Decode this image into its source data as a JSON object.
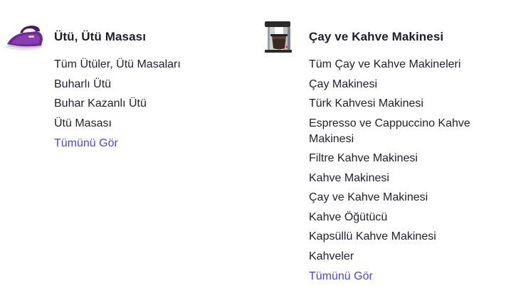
{
  "categories": [
    {
      "title": "Ütü, Ütü Masası",
      "thumbnail_icon": "steam-iron-icon",
      "links": [
        "Tüm Ütüler, Ütü Masaları",
        "Buharlı Ütü",
        "Buhar Kazanlı Ütü",
        "Ütü Masası"
      ],
      "see_all": "Tümünü Gör"
    },
    {
      "title": "Çay ve Kahve Makinesi",
      "thumbnail_icon": "coffee-machine-icon",
      "links": [
        "Tüm Çay ve Kahve Makineleri",
        "Çay Makinesi",
        "Türk Kahvesi Makinesi",
        "Espresso ve Cappuccino Kahve Makinesi",
        "Filtre Kahve Makinesi",
        "Kahve Makinesi",
        "Çay ve Kahve Makinesi",
        "Kahve Öğütücü",
        "Kapsüllü Kahve Makinesi",
        "Kahveler"
      ],
      "see_all": "Tümünü Gör"
    }
  ],
  "colors": {
    "link_accent": "#4b46e0",
    "text": "#1f1f2e"
  }
}
